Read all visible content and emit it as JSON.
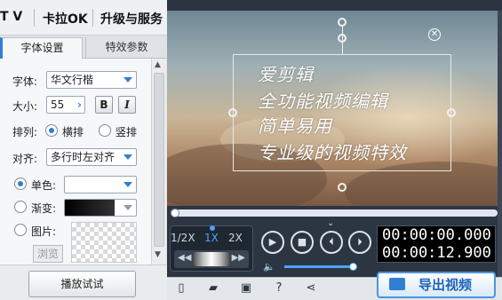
{
  "topbar": {
    "item1": "T V",
    "item2": "卡拉OK",
    "item3": "升级与服务"
  },
  "tabs": {
    "font_settings": "字体设置",
    "effect_params": "特效参数"
  },
  "font": {
    "font_label": "字体:",
    "font_value": "华文行楷",
    "size_label": "大小:",
    "size_value": "55",
    "bold": "B",
    "italic": "I",
    "layout_label": "排列:",
    "layout_horizontal": "横排",
    "layout_vertical": "竖排",
    "align_label": "对齐:",
    "align_value": "多行时左对齐",
    "solid_color": "单色:",
    "gradient": "渐变:",
    "image": "图片:",
    "browse": "浏览",
    "play_test": "播放试试"
  },
  "preview": {
    "lines": [
      "爱剪辑",
      "全功能视频编辑",
      "简单易用",
      "专业级的视频特效"
    ]
  },
  "controls": {
    "speed_half": "1/2X",
    "speed_1x": "1X",
    "speed_2x": "2X",
    "current_time": "00:00:00.000",
    "total_time": "00:00:12.900",
    "progress_fraction": 0.0,
    "volume_fraction": 1.0
  },
  "export": {
    "label": "导出视频"
  },
  "colors": {
    "accent": "#2f7fd3",
    "panel_dark": "#2c3642"
  }
}
